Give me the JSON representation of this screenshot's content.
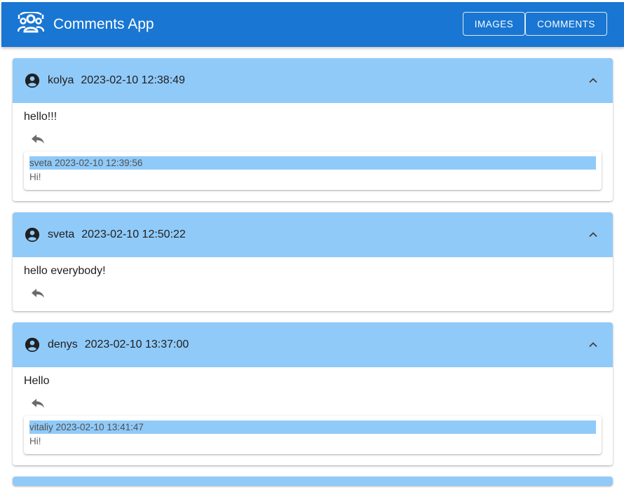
{
  "appbar": {
    "title": "Comments App",
    "logo_icon": "people-group-icon",
    "nav": [
      {
        "label": "IMAGES"
      },
      {
        "label": "COMMENTS"
      }
    ]
  },
  "colors": {
    "appbar": "#1976d2",
    "header": "#90caf9"
  },
  "comments": [
    {
      "author": "kolya",
      "date": "2023-02-10 12:38:49",
      "text": "hello!!!",
      "replies": [
        {
          "meta": "sveta 2023-02-10 12:39:56",
          "text": "Hi!"
        }
      ]
    },
    {
      "author": "sveta",
      "date": "2023-02-10 12:50:22",
      "text": "hello everybody!",
      "replies": []
    },
    {
      "author": "denys",
      "date": "2023-02-10 13:37:00",
      "text": "Hello",
      "replies": [
        {
          "meta": "vitaliy 2023-02-10 13:41:47",
          "text": "Hi!"
        }
      ]
    }
  ]
}
